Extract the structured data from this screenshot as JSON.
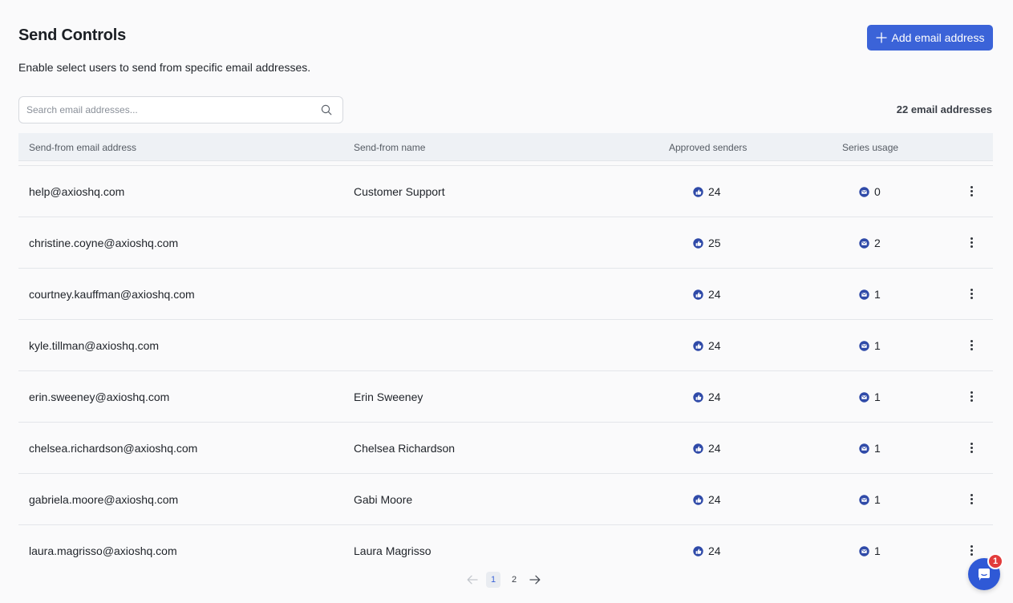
{
  "header": {
    "title": "Send Controls",
    "subtitle": "Enable select users to send from specific email addresses.",
    "add_button_label": "Add email address"
  },
  "search": {
    "placeholder": "Search email addresses...",
    "value": ""
  },
  "count_label": "22 email addresses",
  "table": {
    "columns": {
      "email": "Send-from email address",
      "name": "Send-from name",
      "approved": "Approved senders",
      "series": "Series usage"
    },
    "rows": [
      {
        "email": "help@axioshq.com",
        "name": "Customer Support",
        "approved": "24",
        "series": "0"
      },
      {
        "email": "christine.coyne@axioshq.com",
        "name": "",
        "approved": "25",
        "series": "2"
      },
      {
        "email": "courtney.kauffman@axioshq.com",
        "name": "",
        "approved": "24",
        "series": "1"
      },
      {
        "email": "kyle.tillman@axioshq.com",
        "name": "",
        "approved": "24",
        "series": "1"
      },
      {
        "email": "erin.sweeney@axioshq.com",
        "name": "Erin Sweeney",
        "approved": "24",
        "series": "1"
      },
      {
        "email": "chelsea.richardson@axioshq.com",
        "name": "Chelsea Richardson",
        "approved": "24",
        "series": "1"
      },
      {
        "email": "gabriela.moore@axioshq.com",
        "name": "Gabi Moore",
        "approved": "24",
        "series": "1"
      },
      {
        "email": "laura.magrisso@axioshq.com",
        "name": "Laura Magrisso",
        "approved": "24",
        "series": "1"
      }
    ]
  },
  "pagination": {
    "pages": [
      "1",
      "2"
    ],
    "current": "1"
  },
  "help_widget": {
    "badge_count": "1"
  },
  "icons": {
    "add": "plus-icon",
    "search": "search-icon",
    "approved": "approved-senders-icon",
    "series": "series-usage-icon",
    "row_menu": "more-vertical-icon",
    "prev": "arrow-left-icon",
    "next": "arrow-right-icon",
    "help": "chat-help-icon"
  },
  "colors": {
    "accent": "#3b63d8",
    "icon_blue": "#2f4aa8",
    "badge_red": "#e23b3b"
  }
}
